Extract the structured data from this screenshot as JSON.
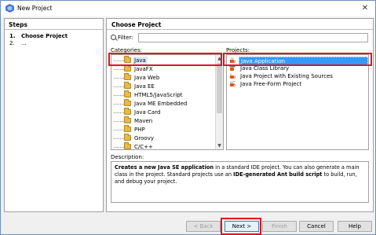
{
  "window": {
    "title": "New Project",
    "close_glyph": "✕"
  },
  "steps": {
    "header": "Steps",
    "items": [
      {
        "num": "1.",
        "label": "Choose Project"
      },
      {
        "num": "2.",
        "label": "..."
      }
    ]
  },
  "main": {
    "header": "Choose Project",
    "filter_label": "Filter:",
    "filter_value": "",
    "categories_label": "Categories:",
    "projects_label": "Projects:",
    "categories": [
      "Java",
      "JavaFX",
      "Java Web",
      "Java EE",
      "HTML5/JavaScript",
      "Java ME Embedded",
      "Java Card",
      "Maven",
      "PHP",
      "Groovy",
      "C/C++"
    ],
    "selected_category": "Java",
    "projects": [
      "Java Application",
      "Java Class Library",
      "Java Project with Existing Sources",
      "Java Free-Form Project"
    ],
    "selected_project": "Java Application",
    "description_label": "Description:",
    "description": {
      "part1": "Creates a new Java SE application",
      "part2": " in a standard IDE project. You can also generate a main class in the project. Standard projects use an ",
      "part3": "IDE-generated Ant build script",
      "part4": " to build, run, and debug your project."
    }
  },
  "buttons": {
    "back": "< Back",
    "next": "Next >",
    "finish": "Finish",
    "cancel": "Cancel",
    "help": "Help"
  },
  "colors": {
    "highlight": "#e0141e",
    "selection": "#3399ff",
    "folder": "#e8b84a"
  }
}
